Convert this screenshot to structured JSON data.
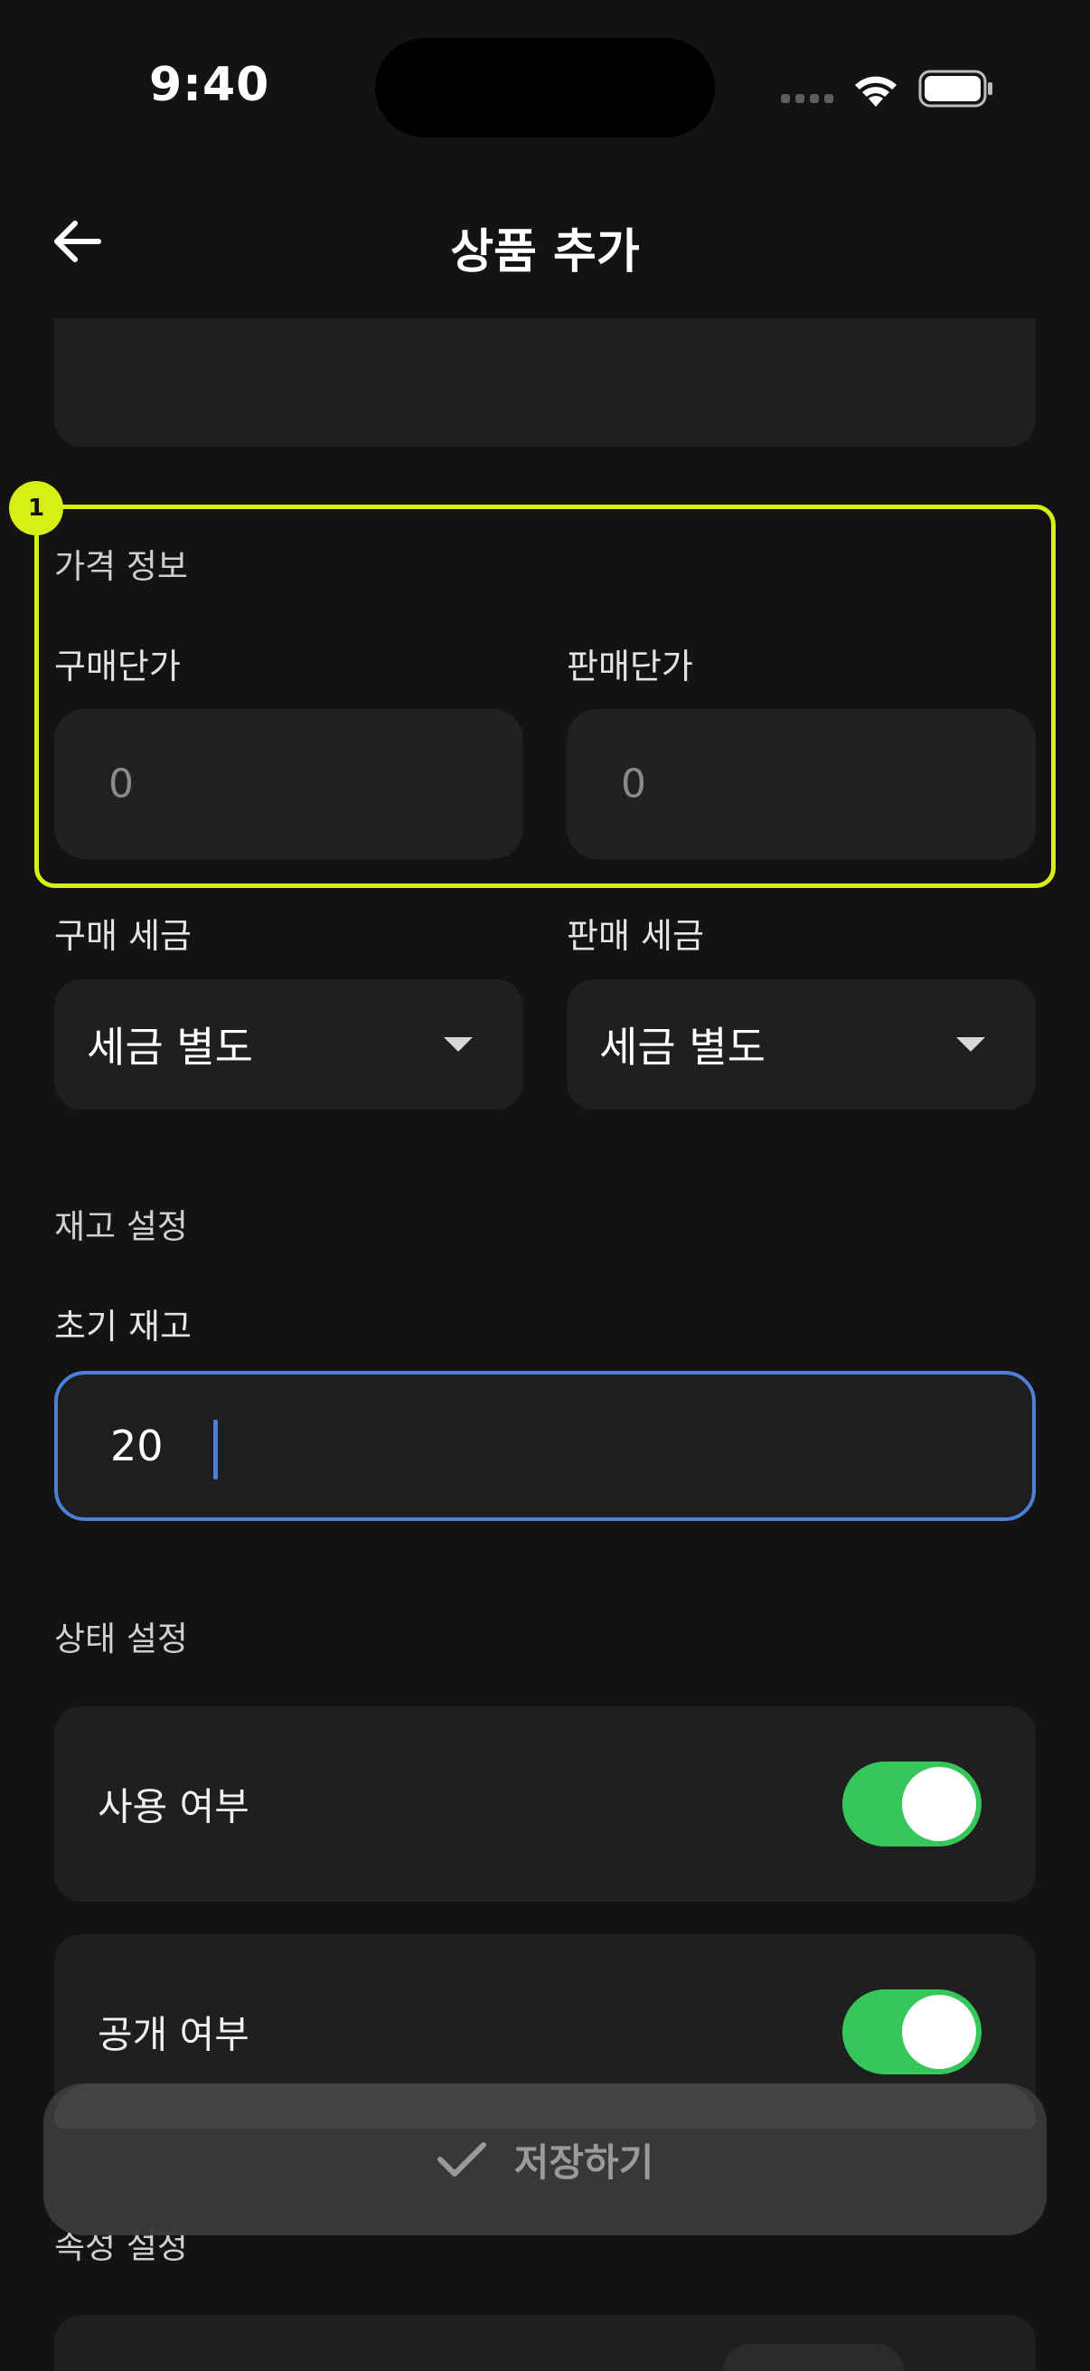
{
  "status_bar": {
    "time": "9:40"
  },
  "header": {
    "title": "상품 추가"
  },
  "price_section": {
    "title": "가격 정보",
    "badge": "1",
    "purchase_price_label": "구매단가",
    "purchase_price_value": "0",
    "sale_price_label": "판매단가",
    "sale_price_value": "0"
  },
  "tax": {
    "purchase_tax_label": "구매 세금",
    "purchase_tax_value": "세금 별도",
    "sale_tax_label": "판매 세금",
    "sale_tax_value": "세금 별도"
  },
  "stock_section": {
    "title": "재고 설정",
    "initial_stock_label": "초기 재고",
    "initial_stock_value": "20"
  },
  "status_section": {
    "title": "상태 설정",
    "use_label": "사용 여부",
    "use_enabled": true,
    "public_label": "공개 여부",
    "public_enabled": true
  },
  "attribute_section": {
    "title": "속성 설정"
  },
  "save_button": {
    "label": "저장하기"
  },
  "colors": {
    "background": "#131313",
    "card": "#1f1f1f",
    "highlight": "#d6f016",
    "focus": "#4e7fd8",
    "toggle_on": "#35c759"
  }
}
